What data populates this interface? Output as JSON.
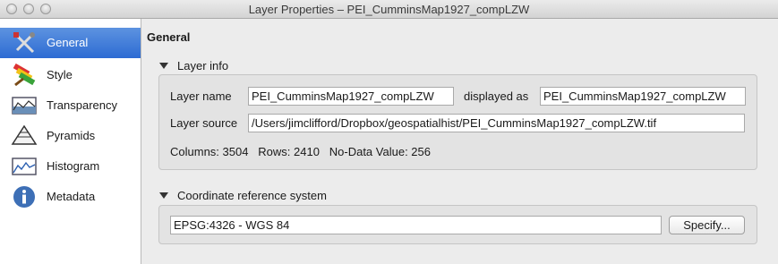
{
  "window": {
    "title": "Layer Properties – PEI_CumminsMap1927_compLZW"
  },
  "sidebar": {
    "items": [
      {
        "label": "General",
        "icon": "general-tools-icon",
        "active": true
      },
      {
        "label": "Style",
        "icon": "paintbrush-icon"
      },
      {
        "label": "Transparency",
        "icon": "transparency-icon"
      },
      {
        "label": "Pyramids",
        "icon": "pyramids-icon"
      },
      {
        "label": "Histogram",
        "icon": "histogram-icon"
      },
      {
        "label": "Metadata",
        "icon": "info-icon"
      }
    ]
  },
  "main": {
    "title": "General",
    "layer_info": {
      "header": "Layer info",
      "layer_name_label": "Layer name",
      "layer_name_value": "PEI_CumminsMap1927_compLZW",
      "displayed_as_label": "displayed as",
      "displayed_as_value": "PEI_CumminsMap1927_compLZW",
      "layer_source_label": "Layer source",
      "layer_source_value": "/Users/jimclifford/Dropbox/geospatialhist/PEI_CumminsMap1927_compLZW.tif",
      "stats": "Columns: 3504   Rows: 2410   No-Data Value: 256"
    },
    "crs": {
      "header": "Coordinate reference system",
      "value": "EPSG:4326 - WGS 84",
      "specify_label": "Specify..."
    }
  },
  "colors": {
    "selection": "#3d7bdb",
    "sidebar_bg": "#ffffff",
    "panel_bg": "#ececec"
  }
}
